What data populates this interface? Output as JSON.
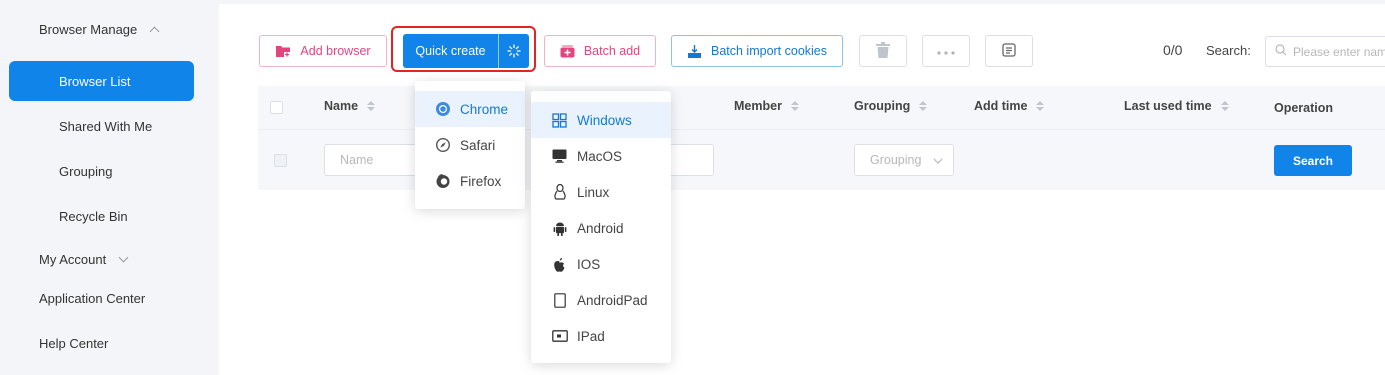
{
  "sidebar": {
    "browser_manage": "Browser Manage",
    "browser_list": "Browser List",
    "shared_with_me": "Shared With Me",
    "grouping": "Grouping",
    "recycle_bin": "Recycle Bin",
    "my_account": "My Account",
    "application_center": "Application Center",
    "help_center": "Help Center"
  },
  "toolbar": {
    "add_browser": "Add browser",
    "quick_create": "Quick create",
    "batch_add": "Batch add",
    "batch_import_cookies": "Batch import cookies",
    "count": "0/0",
    "search_label": "Search:",
    "search_placeholder": "Please enter name"
  },
  "table": {
    "columns": {
      "name": "Name",
      "member": "Member",
      "grouping": "Grouping",
      "add_time": "Add time",
      "last_used_time": "Last used time",
      "operation": "Operation"
    },
    "filter": {
      "name_placeholder": "Name",
      "grouping_placeholder": "Grouping",
      "search_button": "Search"
    }
  },
  "browser_menu": {
    "items": [
      {
        "label": "Chrome",
        "icon": "chrome-icon",
        "active": true
      },
      {
        "label": "Safari",
        "icon": "safari-icon",
        "active": false
      },
      {
        "label": "Firefox",
        "icon": "firefox-icon",
        "active": false
      }
    ]
  },
  "os_menu": {
    "items": [
      {
        "label": "Windows",
        "icon": "windows-icon",
        "active": true
      },
      {
        "label": "MacOS",
        "icon": "monitor-icon",
        "active": false
      },
      {
        "label": "Linux",
        "icon": "linux-icon",
        "active": false
      },
      {
        "label": "Android",
        "icon": "android-icon",
        "active": false
      },
      {
        "label": "IOS",
        "icon": "apple-icon",
        "active": false
      },
      {
        "label": "AndroidPad",
        "icon": "tablet-icon",
        "active": false
      },
      {
        "label": "IPad",
        "icon": "ipad-icon",
        "active": false
      }
    ]
  },
  "colors": {
    "primary": "#1084e8",
    "pink": "#e3457f",
    "highlight_border": "#e32424"
  }
}
